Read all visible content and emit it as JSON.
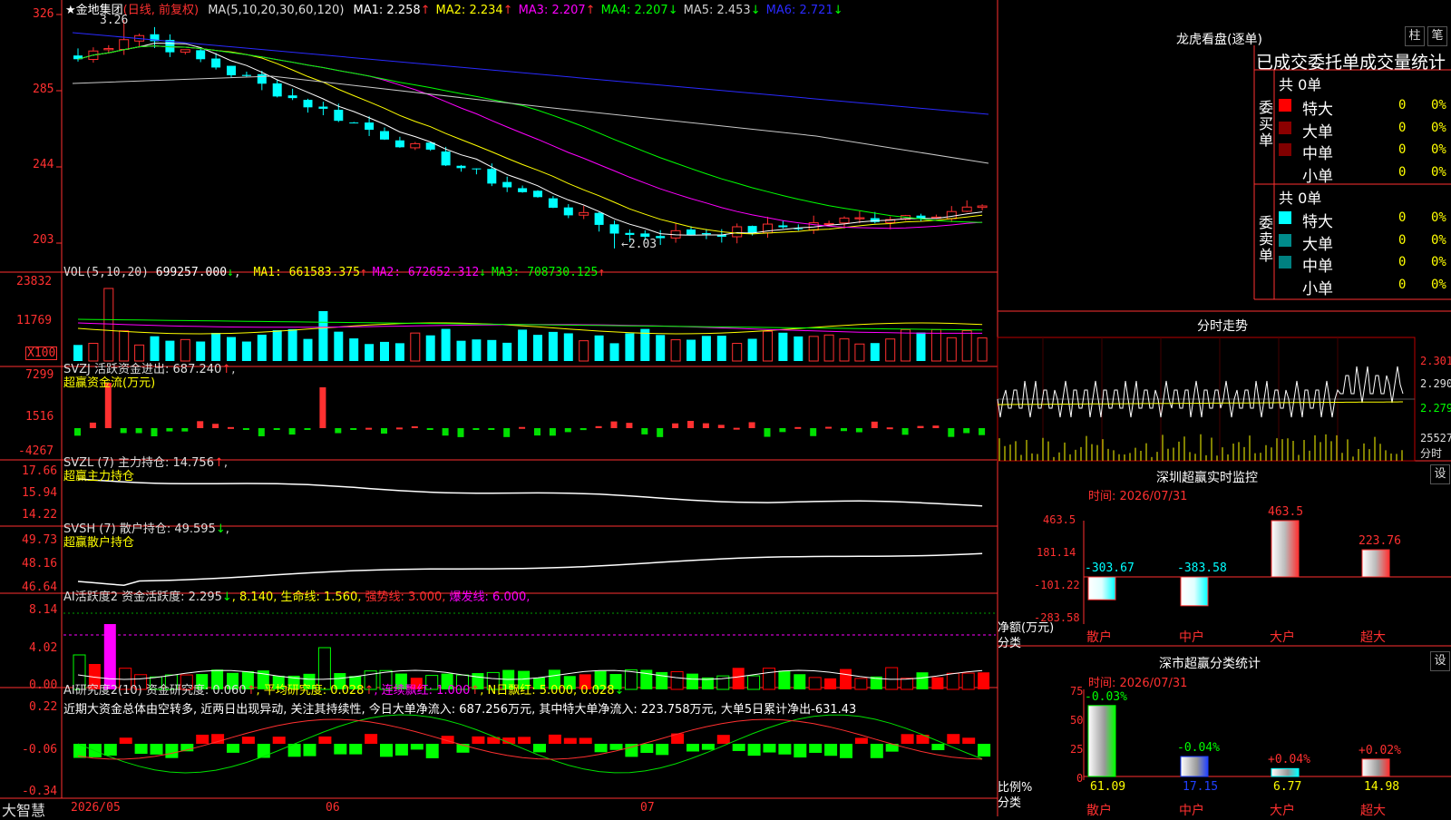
{
  "app": {
    "logo_text": "大智慧",
    "stock_name": "★金地集团",
    "period": "(日线, 前复权)"
  },
  "price": {
    "ma_label": "MA(5,10,20,30,60,120)",
    "ma": [
      {
        "label": "MA1: 2.258",
        "arrow": "↑",
        "color": "#ffffff"
      },
      {
        "label": "MA2: 2.234",
        "arrow": "↑",
        "color": "#ffff00"
      },
      {
        "label": "MA3: 2.207",
        "arrow": "↑",
        "color": "#ff00ff"
      },
      {
        "label": "MA4: 2.207",
        "arrow": "↓",
        "color": "#00ff00"
      },
      {
        "label": "MA5: 2.453",
        "arrow": "↓",
        "color": "#d0d0d0"
      },
      {
        "label": "MA6: 2.721",
        "arrow": "↓",
        "color": "#2a2aff"
      }
    ],
    "y_ticks": [
      "326",
      "285",
      "244",
      "203"
    ],
    "hi_label": "3.26",
    "lo_label": "←2.03",
    "hi_value": 3.26,
    "lo_value": 2.03
  },
  "vol": {
    "title": "VOL(5,10,20)",
    "value": "699257.000",
    "value_arrow": "↓",
    "ma": [
      {
        "label": "MA1: 661583.375",
        "arrow": "↑",
        "color": "#ffff00"
      },
      {
        "label": "MA2: 672652.312",
        "arrow": "↓",
        "color": "#ff00ff"
      },
      {
        "label": "MA3: 708730.125",
        "arrow": "↑",
        "color": "#00ff00"
      }
    ],
    "y_ticks": [
      "23832",
      "11769",
      "X100"
    ]
  },
  "svzj": {
    "title": "SVZJ  活跃资金进出: 687.240",
    "arrow": "↑",
    "tail": ",",
    "subtitle": "超赢资金流(万元)",
    "y_ticks": [
      "7299",
      "1516",
      "-4267"
    ]
  },
  "svzl": {
    "title": "SVZL (7) 主力持仓: 14.756",
    "arrow": "↑",
    "tail": ",",
    "subtitle": "超赢主力持仓",
    "y_ticks": [
      "17.66",
      "15.94",
      "14.22"
    ]
  },
  "svsh": {
    "title": "SVSH (7) 散户持仓: 49.595",
    "arrow": "↓",
    "tail": ",",
    "subtitle": "超赢散户持仓",
    "y_ticks": [
      "49.73",
      "48.16",
      "46.64"
    ]
  },
  "ai1": {
    "title": "AI活跃度2 资金活跃度: 2.295",
    "arrow1": "↓",
    "t2": ", 8.140, 生命线: 1.560,",
    "strong": "强势线: 3.000,",
    "burst": "爆发线: 6.000,",
    "y_ticks": [
      "8.14",
      "4.02",
      "0.00"
    ]
  },
  "ai2": {
    "title": "AI研究度2(10) 资金研究度: 0.060",
    "arrow1": "↑",
    "t2": ", 平均研究度: 0.028",
    "arrow2": "↑",
    "t3": ", 连续飘红: 1.000",
    "arrow3": "↑",
    "t4": ", N日飘红: 5.000, 0.028",
    "arrow4": "↓",
    "summary": "近期大资金总体由空转多, 近两日出现异动, 关注其持续性, 今日大单净流入: 687.256万元, 其中特大单净流入: 223.758万元, 大单5日累计净出-631.43",
    "y_ticks": [
      "0.22",
      "-0.06",
      "-0.34"
    ]
  },
  "x_axis": [
    "2026/05",
    "06",
    "07"
  ],
  "right": {
    "dragon_title": "龙虎看盘(逐单)",
    "btn_col": "柱",
    "btn_tick": "笔",
    "header": "已成交委托单成交量统计",
    "buy": {
      "side_label": "委买单",
      "total": "共 0单",
      "rows": [
        {
          "name": "特大",
          "color": "#ff0000",
          "n": "0",
          "pct": "0%"
        },
        {
          "name": "大单",
          "color": "#8b0000",
          "n": "0",
          "pct": "0%"
        },
        {
          "name": "中单",
          "color": "#800000",
          "n": "0",
          "pct": "0%"
        },
        {
          "name": "小单",
          "color": "#000000",
          "n": "0",
          "pct": "0%"
        }
      ]
    },
    "sell": {
      "side_label": "委卖单",
      "total": "共 0单",
      "rows": [
        {
          "name": "特大",
          "color": "#00ffff",
          "n": "0",
          "pct": "0%"
        },
        {
          "name": "大单",
          "color": "#008b8b",
          "n": "0",
          "pct": "0%"
        },
        {
          "name": "中单",
          "color": "#008080",
          "n": "0",
          "pct": "0%"
        },
        {
          "name": "小单",
          "color": "#000000",
          "n": "0",
          "pct": "0%"
        }
      ]
    },
    "intraday": {
      "title": "分时走势",
      "ticks": [
        "2.301",
        "2.290",
        "2.279"
      ],
      "vol_label": "25527",
      "unit": "分时"
    },
    "sz_monitor": {
      "title": "深圳超赢实时监控",
      "btn": "设",
      "time": "时间: 2026/07/31",
      "y_ticks": [
        "463.5",
        "181.14",
        "-101.22",
        "-283.58"
      ],
      "ylabel1": "净额(万元)",
      "ylabel2": "分类"
    },
    "sz_class": {
      "title": "深市超赢分类统计",
      "btn": "设",
      "time": "时间: 2026/07/31",
      "y_ticks": [
        "75",
        "50",
        "25",
        "0"
      ],
      "ylabel1": "比例%",
      "ylabel2": "分类"
    }
  },
  "chart_data": [
    {
      "type": "bar",
      "title": "深圳超赢实时监控",
      "categories": [
        "散户",
        "中户",
        "大户",
        "超大"
      ],
      "values": [
        -303.67,
        -383.58,
        463.5,
        223.76
      ],
      "value_labels": [
        "-303.67",
        "-383.58",
        "463.5",
        "223.76"
      ],
      "ylim": [
        -283.58,
        463.5
      ],
      "ylabel": "净额(万元)"
    },
    {
      "type": "bar",
      "title": "深市超赢分类统计",
      "categories": [
        "散户",
        "中户",
        "大户",
        "超大"
      ],
      "values": [
        61.09,
        17.15,
        6.77,
        14.98
      ],
      "value_labels": [
        "61.09",
        "17.15",
        "6.77",
        "14.98"
      ],
      "change_labels": [
        "-0.03%",
        "-0.04%",
        "+0.04%",
        "+0.02%"
      ],
      "ylim": [
        0,
        75
      ],
      "ylabel": "比例%"
    }
  ]
}
